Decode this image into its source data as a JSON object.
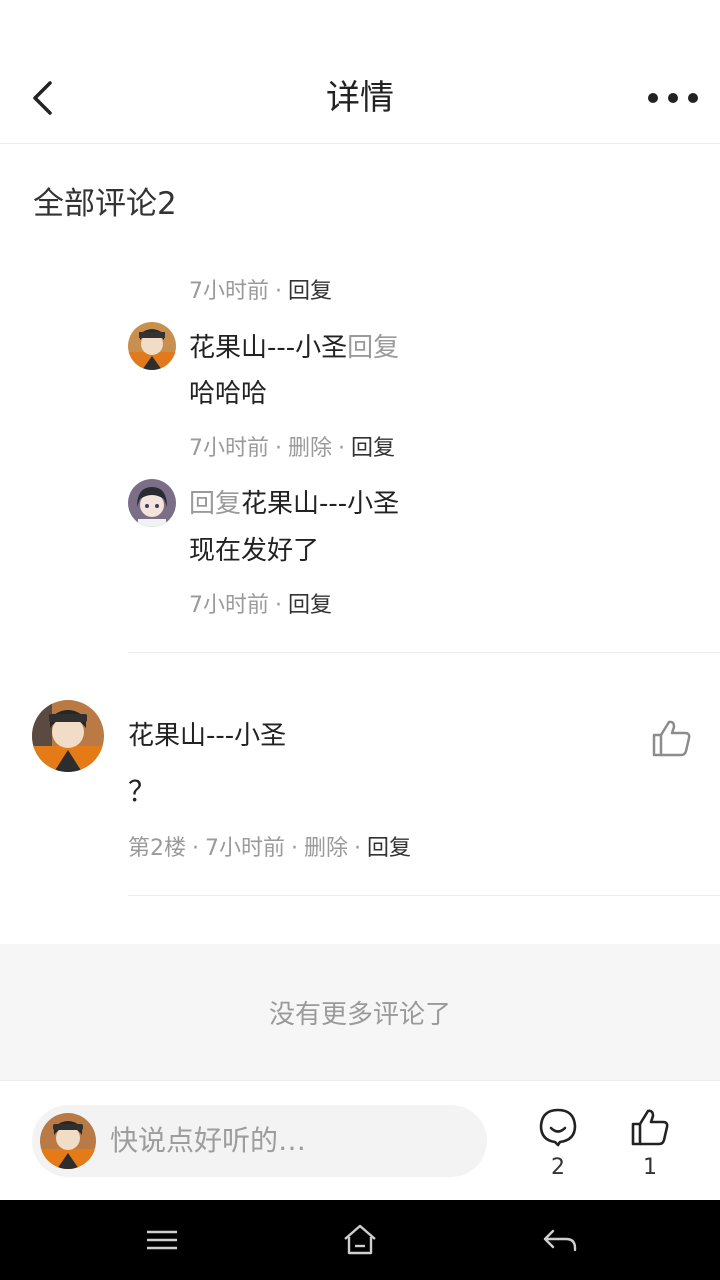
{
  "header": {
    "title": "详情"
  },
  "comments": {
    "section_title": "全部评论2",
    "thread": {
      "top_meta": {
        "time": "7小时前",
        "reply": "回复"
      },
      "replies": [
        {
          "author": "花果山---小圣",
          "reply_word": "回复",
          "text": "哈哈哈",
          "time": "7小时前",
          "delete": "删除",
          "reply": "回复"
        },
        {
          "reply_word": "回复",
          "target": "花果山---小圣",
          "text": "现在发好了",
          "time": "7小时前",
          "reply": "回复"
        }
      ]
    },
    "main": {
      "author": "花果山---小圣",
      "text": "？",
      "floor": "第2楼",
      "time": "7小时前",
      "delete": "删除",
      "reply": "回复"
    },
    "no_more": "没有更多评论了"
  },
  "bottom_bar": {
    "placeholder": "快说点好听的…",
    "comment_count": "2",
    "like_count": "1"
  },
  "colors": {
    "text": "#222222",
    "muted": "#9a9a9a",
    "background_gray": "#f6f6f6"
  }
}
